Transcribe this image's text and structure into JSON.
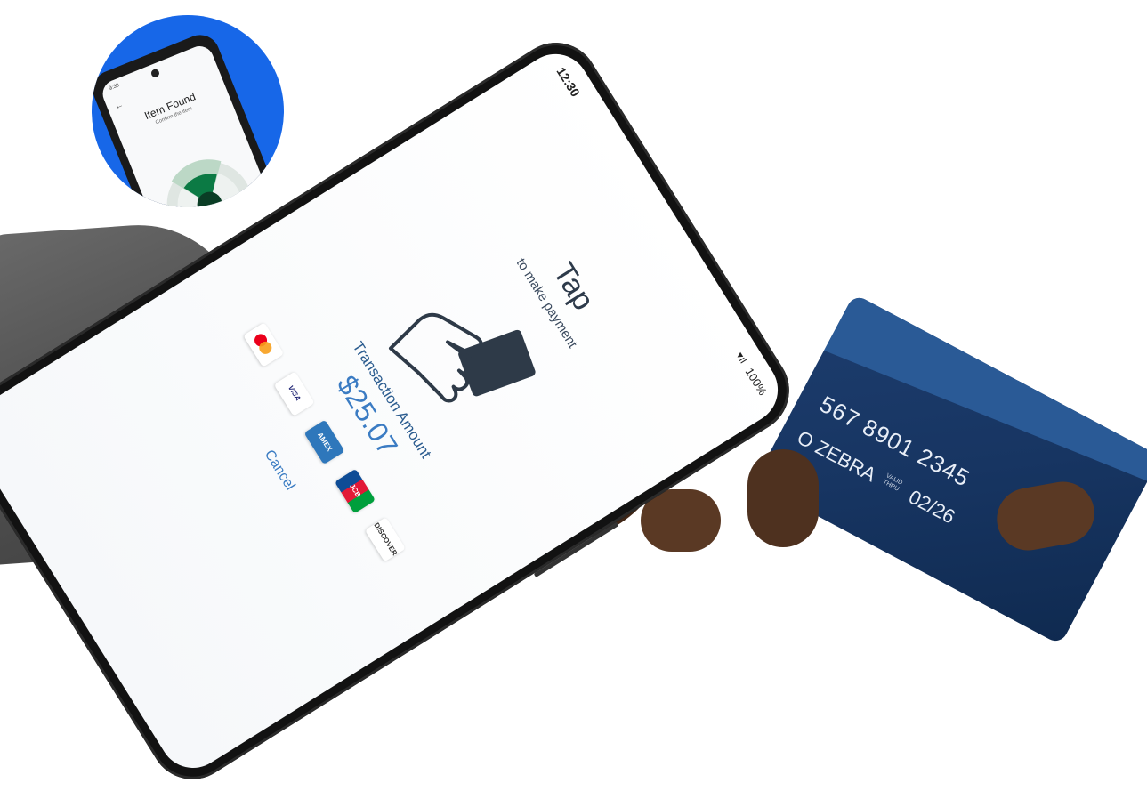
{
  "inset": {
    "status_time": "9:30",
    "title": "Item Found",
    "subtitle": "Confirm the item"
  },
  "phone": {
    "status": {
      "time": "12:30",
      "battery": "100%"
    },
    "title": "Tap",
    "subtitle": "to make payment",
    "amount_label": "Transaction Amount",
    "amount_value": "$25.07",
    "card_logos": [
      {
        "name": "mastercard",
        "label": ""
      },
      {
        "name": "visa",
        "label": "VISA"
      },
      {
        "name": "amex",
        "label": "AMEX"
      },
      {
        "name": "jcb",
        "label": "JCB"
      },
      {
        "name": "discover",
        "label": "DISCOVER"
      }
    ],
    "cancel_label": "Cancel"
  },
  "card": {
    "number_fragment": "567 8901 2345",
    "name_fragment": "O ZEBRA",
    "valid_label": "VALID THRU",
    "expiry_fragment": "02/26"
  },
  "colors": {
    "inset_background": "#1767e8",
    "accent_blue": "#3b7cc3",
    "card_navy": "#173562",
    "radar_green": "#0b7a44"
  },
  "icons": {
    "tap": "hand-holding-card-icon",
    "radar": "radar-icon",
    "back": "back-arrow-icon"
  }
}
